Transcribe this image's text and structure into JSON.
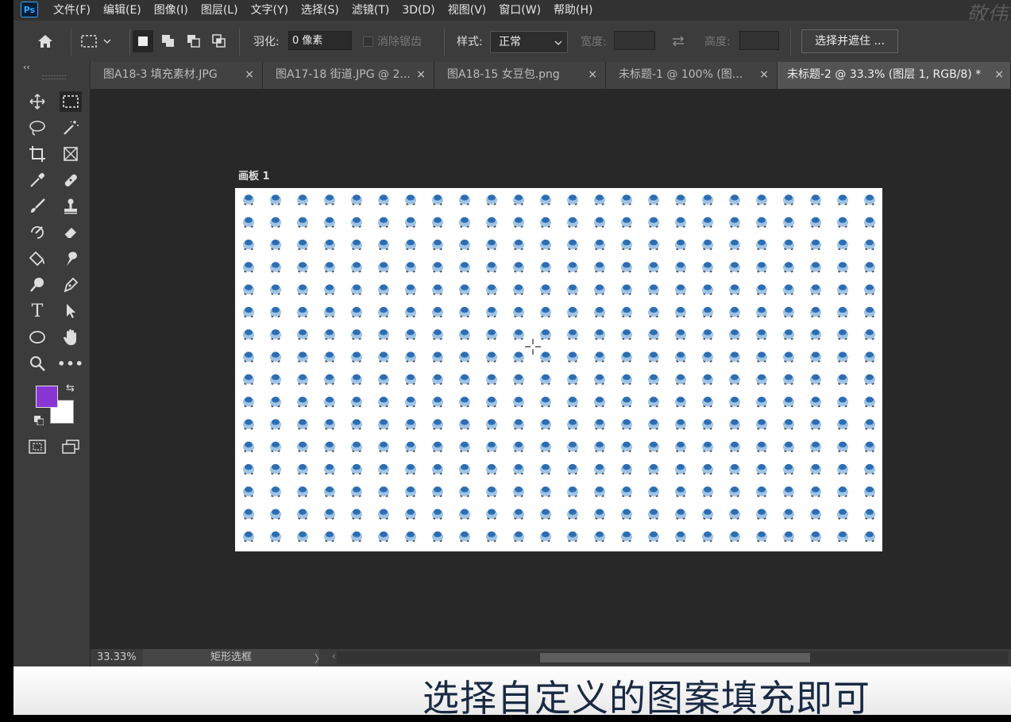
{
  "app": {
    "logo": "Ps",
    "watermark": "敬伟"
  },
  "menu": [
    "文件(F)",
    "编辑(E)",
    "图像(I)",
    "图层(L)",
    "文字(Y)",
    "选择(S)",
    "滤镜(T)",
    "3D(D)",
    "视图(V)",
    "窗口(W)",
    "帮助(H)"
  ],
  "options": {
    "feather_label": "羽化:",
    "feather_value": "0 像素",
    "antialias_label": "消除锯齿",
    "style_label": "样式:",
    "style_value": "正常",
    "width_label": "宽度:",
    "height_label": "高度:",
    "select_mask_button": "选择并遮住 ..."
  },
  "tabs": [
    {
      "label": "图A18-3 填充素材.JPG",
      "active": false
    },
    {
      "label": "图A17-18 街道.JPG @ 2...",
      "active": false
    },
    {
      "label": "图A18-15 女豆包.png",
      "active": false
    },
    {
      "label": "未标题-1 @ 100% (图...",
      "active": false
    },
    {
      "label": "未标题-2 @ 33.3% (图层 1, RGB/8) *",
      "active": true
    }
  ],
  "tab_close": "×",
  "canvas": {
    "artboard_label": "画板 1"
  },
  "colors": {
    "foreground": "#8a36d6",
    "background": "#ffffff"
  },
  "status": {
    "zoom": "33.33%",
    "tool": "矩形选框",
    "arrow": "〉",
    "scroll_left": "‹"
  },
  "subtitle": "选择自定义的图案填充即可",
  "tools": [
    "move-icon",
    "rect-marquee-icon",
    "lasso-icon",
    "magic-wand-icon",
    "crop-icon",
    "frame-icon",
    "eyedropper-icon",
    "healing-brush-icon",
    "brush-icon",
    "stamp-icon",
    "history-brush-icon",
    "eraser-icon",
    "paint-bucket-icon",
    "smudge-icon",
    "dodge-icon",
    "pen-icon",
    "type-icon",
    "path-select-icon",
    "ellipse-icon",
    "hand-icon",
    "zoom-icon",
    "more-icon",
    "quick-mask-icon",
    "screen-mode-icon"
  ]
}
